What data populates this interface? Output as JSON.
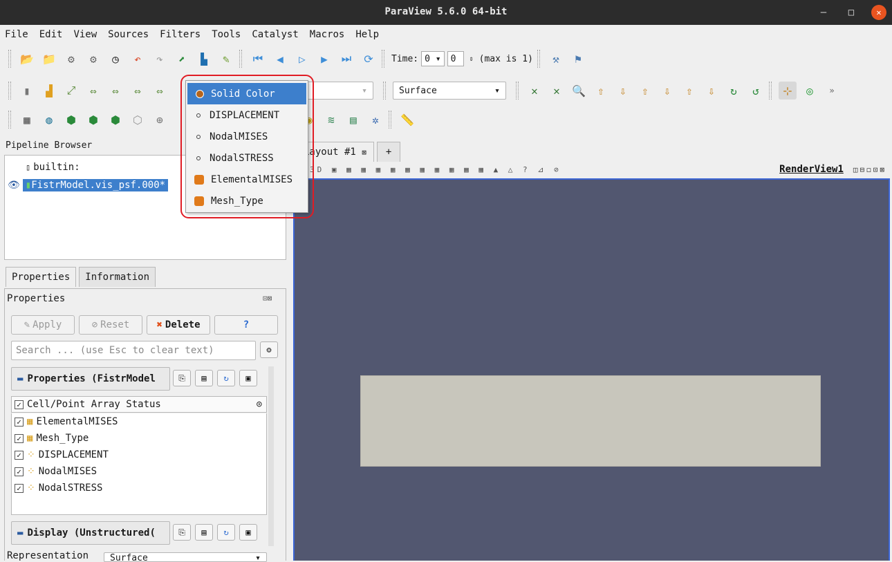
{
  "window": {
    "title": "ParaView 5.6.0 64-bit",
    "minimize": "–",
    "maximize": "□",
    "close": "✕"
  },
  "menu": [
    "File",
    "Edit",
    "View",
    "Sources",
    "Filters",
    "Tools",
    "Catalyst",
    "Macros",
    "Help"
  ],
  "time_toolbar": {
    "label": "Time:",
    "value1": "0",
    "value2": "0",
    "max_text": "(max is 1)"
  },
  "representation_combo": "Surface",
  "color_popup": {
    "items": [
      {
        "label": "Solid Color",
        "icon": "solid-color-dot-icon",
        "selected": true
      },
      {
        "label": "DISPLACEMENT",
        "icon": "point-data-icon"
      },
      {
        "label": "NodalMISES",
        "icon": "point-data-icon"
      },
      {
        "label": "NodalSTRESS",
        "icon": "point-data-icon"
      },
      {
        "label": "ElementalMISES",
        "icon": "cell-data-icon"
      },
      {
        "label": "Mesh_Type",
        "icon": "cell-data-icon"
      }
    ]
  },
  "pipeline": {
    "header": "Pipeline Browser",
    "builtin": "builtin:",
    "item": "FistrModel.vis_psf.000*"
  },
  "tabs": {
    "properties": "Properties",
    "information": "Information"
  },
  "properties": {
    "header": "Properties",
    "apply": "Apply",
    "reset": "Reset",
    "delete": "Delete",
    "help": "?",
    "search_placeholder": "Search ... (use Esc to clear text)",
    "section1": "Properties (FistrModel",
    "array_header": "Cell/Point Array Status",
    "arrays": [
      "ElementalMISES",
      "Mesh_Type",
      "DISPLACEMENT",
      "NodalMISES",
      "NodalSTRESS"
    ],
    "section2": "Display (Unstructured(",
    "representation_label": "Representation",
    "representation_value": "Surface"
  },
  "view": {
    "layout_tab": "Layout #1",
    "add_tab": "+",
    "render_view_label": "RenderView1",
    "background": "#525770",
    "mesh_color": "#c8c6bc"
  }
}
